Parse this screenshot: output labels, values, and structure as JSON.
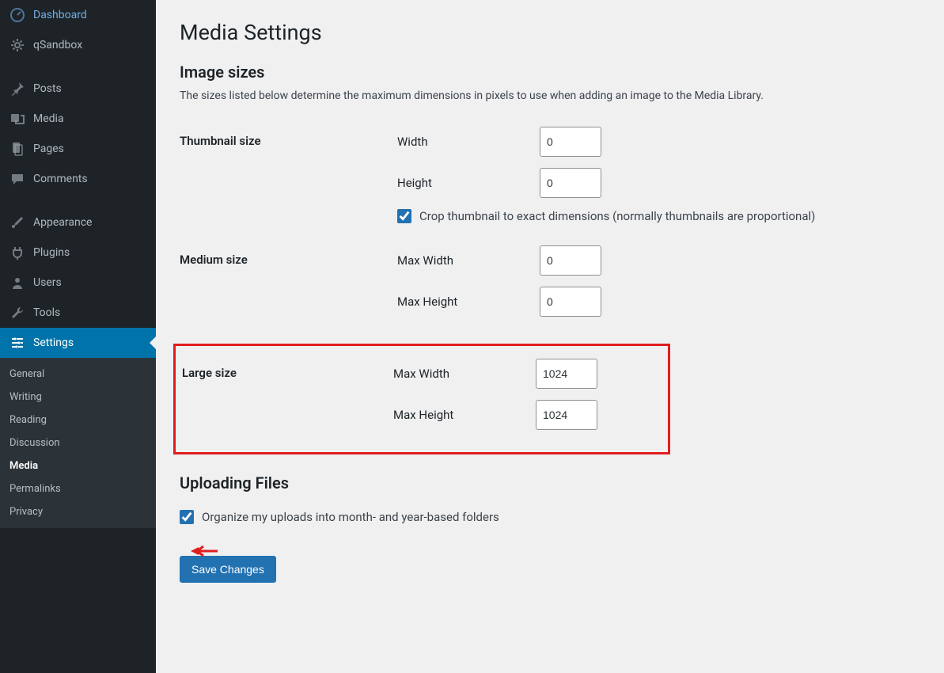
{
  "sidebar": {
    "items": [
      {
        "label": "Dashboard",
        "icon": "dashboard"
      },
      {
        "label": "qSandbox",
        "icon": "gear"
      }
    ],
    "contentItems": [
      {
        "label": "Posts",
        "icon": "pin"
      },
      {
        "label": "Media",
        "icon": "media"
      },
      {
        "label": "Pages",
        "icon": "pages"
      },
      {
        "label": "Comments",
        "icon": "comment"
      }
    ],
    "adminItems": [
      {
        "label": "Appearance",
        "icon": "brush"
      },
      {
        "label": "Plugins",
        "icon": "plug"
      },
      {
        "label": "Users",
        "icon": "user"
      },
      {
        "label": "Tools",
        "icon": "wrench"
      },
      {
        "label": "Settings",
        "icon": "sliders",
        "active": true
      }
    ],
    "submenu": [
      {
        "label": "General"
      },
      {
        "label": "Writing"
      },
      {
        "label": "Reading"
      },
      {
        "label": "Discussion"
      },
      {
        "label": "Media",
        "current": true
      },
      {
        "label": "Permalinks"
      },
      {
        "label": "Privacy"
      }
    ]
  },
  "page": {
    "title": "Media Settings",
    "section1_heading": "Image sizes",
    "section1_desc": "The sizes listed below determine the maximum dimensions in pixels to use when adding an image to the Media Library.",
    "thumbnail": {
      "label": "Thumbnail size",
      "width_label": "Width",
      "width_value": "0",
      "height_label": "Height",
      "height_value": "0",
      "crop_checked": true,
      "crop_label": "Crop thumbnail to exact dimensions (normally thumbnails are proportional)"
    },
    "medium": {
      "label": "Medium size",
      "maxw_label": "Max Width",
      "maxw_value": "0",
      "maxh_label": "Max Height",
      "maxh_value": "0"
    },
    "large": {
      "label": "Large size",
      "maxw_label": "Max Width",
      "maxw_value": "1024",
      "maxh_label": "Max Height",
      "maxh_value": "1024"
    },
    "uploading": {
      "heading": "Uploading Files",
      "organize_checked": true,
      "organize_label": "Organize my uploads into month- and year-based folders"
    },
    "save_label": "Save Changes"
  }
}
